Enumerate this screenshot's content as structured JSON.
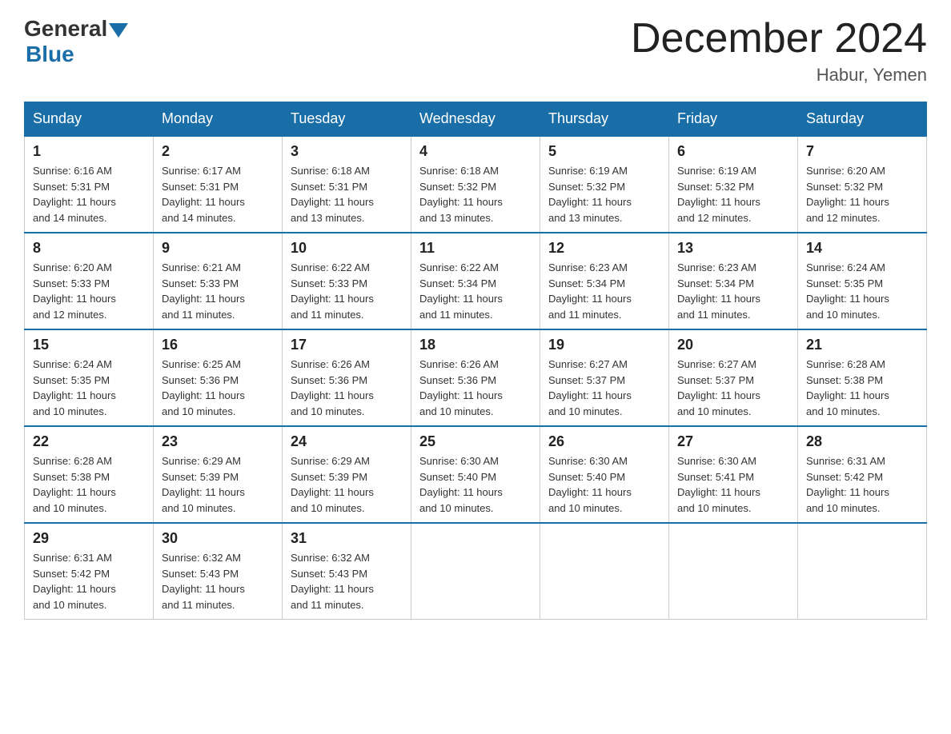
{
  "header": {
    "logo": {
      "general": "General",
      "blue": "Blue"
    },
    "title": "December 2024",
    "location": "Habur, Yemen"
  },
  "days_of_week": [
    "Sunday",
    "Monday",
    "Tuesday",
    "Wednesday",
    "Thursday",
    "Friday",
    "Saturday"
  ],
  "weeks": [
    [
      {
        "day": "1",
        "sunrise": "6:16 AM",
        "sunset": "5:31 PM",
        "daylight": "11 hours and 14 minutes."
      },
      {
        "day": "2",
        "sunrise": "6:17 AM",
        "sunset": "5:31 PM",
        "daylight": "11 hours and 14 minutes."
      },
      {
        "day": "3",
        "sunrise": "6:18 AM",
        "sunset": "5:31 PM",
        "daylight": "11 hours and 13 minutes."
      },
      {
        "day": "4",
        "sunrise": "6:18 AM",
        "sunset": "5:32 PM",
        "daylight": "11 hours and 13 minutes."
      },
      {
        "day": "5",
        "sunrise": "6:19 AM",
        "sunset": "5:32 PM",
        "daylight": "11 hours and 13 minutes."
      },
      {
        "day": "6",
        "sunrise": "6:19 AM",
        "sunset": "5:32 PM",
        "daylight": "11 hours and 12 minutes."
      },
      {
        "day": "7",
        "sunrise": "6:20 AM",
        "sunset": "5:32 PM",
        "daylight": "11 hours and 12 minutes."
      }
    ],
    [
      {
        "day": "8",
        "sunrise": "6:20 AM",
        "sunset": "5:33 PM",
        "daylight": "11 hours and 12 minutes."
      },
      {
        "day": "9",
        "sunrise": "6:21 AM",
        "sunset": "5:33 PM",
        "daylight": "11 hours and 11 minutes."
      },
      {
        "day": "10",
        "sunrise": "6:22 AM",
        "sunset": "5:33 PM",
        "daylight": "11 hours and 11 minutes."
      },
      {
        "day": "11",
        "sunrise": "6:22 AM",
        "sunset": "5:34 PM",
        "daylight": "11 hours and 11 minutes."
      },
      {
        "day": "12",
        "sunrise": "6:23 AM",
        "sunset": "5:34 PM",
        "daylight": "11 hours and 11 minutes."
      },
      {
        "day": "13",
        "sunrise": "6:23 AM",
        "sunset": "5:34 PM",
        "daylight": "11 hours and 11 minutes."
      },
      {
        "day": "14",
        "sunrise": "6:24 AM",
        "sunset": "5:35 PM",
        "daylight": "11 hours and 10 minutes."
      }
    ],
    [
      {
        "day": "15",
        "sunrise": "6:24 AM",
        "sunset": "5:35 PM",
        "daylight": "11 hours and 10 minutes."
      },
      {
        "day": "16",
        "sunrise": "6:25 AM",
        "sunset": "5:36 PM",
        "daylight": "11 hours and 10 minutes."
      },
      {
        "day": "17",
        "sunrise": "6:26 AM",
        "sunset": "5:36 PM",
        "daylight": "11 hours and 10 minutes."
      },
      {
        "day": "18",
        "sunrise": "6:26 AM",
        "sunset": "5:36 PM",
        "daylight": "11 hours and 10 minutes."
      },
      {
        "day": "19",
        "sunrise": "6:27 AM",
        "sunset": "5:37 PM",
        "daylight": "11 hours and 10 minutes."
      },
      {
        "day": "20",
        "sunrise": "6:27 AM",
        "sunset": "5:37 PM",
        "daylight": "11 hours and 10 minutes."
      },
      {
        "day": "21",
        "sunrise": "6:28 AM",
        "sunset": "5:38 PM",
        "daylight": "11 hours and 10 minutes."
      }
    ],
    [
      {
        "day": "22",
        "sunrise": "6:28 AM",
        "sunset": "5:38 PM",
        "daylight": "11 hours and 10 minutes."
      },
      {
        "day": "23",
        "sunrise": "6:29 AM",
        "sunset": "5:39 PM",
        "daylight": "11 hours and 10 minutes."
      },
      {
        "day": "24",
        "sunrise": "6:29 AM",
        "sunset": "5:39 PM",
        "daylight": "11 hours and 10 minutes."
      },
      {
        "day": "25",
        "sunrise": "6:30 AM",
        "sunset": "5:40 PM",
        "daylight": "11 hours and 10 minutes."
      },
      {
        "day": "26",
        "sunrise": "6:30 AM",
        "sunset": "5:40 PM",
        "daylight": "11 hours and 10 minutes."
      },
      {
        "day": "27",
        "sunrise": "6:30 AM",
        "sunset": "5:41 PM",
        "daylight": "11 hours and 10 minutes."
      },
      {
        "day": "28",
        "sunrise": "6:31 AM",
        "sunset": "5:42 PM",
        "daylight": "11 hours and 10 minutes."
      }
    ],
    [
      {
        "day": "29",
        "sunrise": "6:31 AM",
        "sunset": "5:42 PM",
        "daylight": "11 hours and 10 minutes."
      },
      {
        "day": "30",
        "sunrise": "6:32 AM",
        "sunset": "5:43 PM",
        "daylight": "11 hours and 11 minutes."
      },
      {
        "day": "31",
        "sunrise": "6:32 AM",
        "sunset": "5:43 PM",
        "daylight": "11 hours and 11 minutes."
      },
      null,
      null,
      null,
      null
    ]
  ],
  "labels": {
    "sunrise": "Sunrise:",
    "sunset": "Sunset:",
    "daylight": "Daylight:"
  }
}
